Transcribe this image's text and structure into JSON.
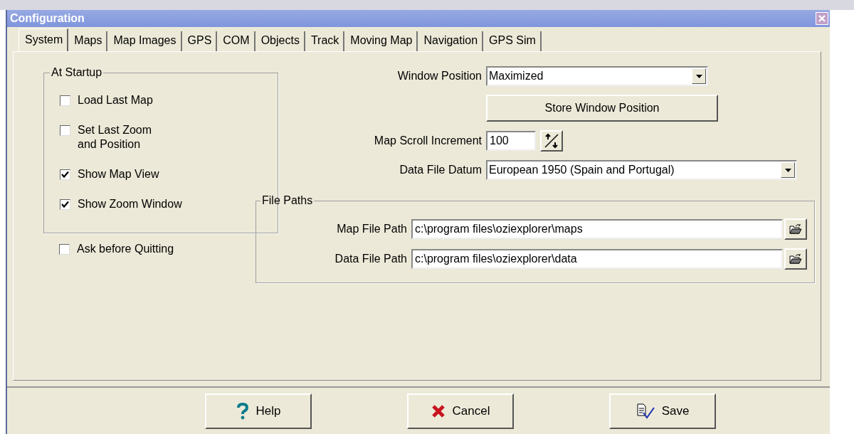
{
  "window": {
    "title": "Configuration"
  },
  "tabs": [
    {
      "label": "System",
      "selected": true
    },
    {
      "label": "Maps",
      "selected": false
    },
    {
      "label": "Map Images",
      "selected": false
    },
    {
      "label": "GPS",
      "selected": false
    },
    {
      "label": "COM",
      "selected": false
    },
    {
      "label": "Objects",
      "selected": false
    },
    {
      "label": "Track",
      "selected": false
    },
    {
      "label": "Moving Map",
      "selected": false
    },
    {
      "label": "Navigation",
      "selected": false
    },
    {
      "label": "GPS Sim",
      "selected": false
    }
  ],
  "at_startup": {
    "title": "At Startup",
    "options": [
      {
        "label": "Load Last Map",
        "checked": false
      },
      {
        "label": "Set Last Zoom\nand Position",
        "checked": false
      },
      {
        "label": "Show Map View",
        "checked": true
      },
      {
        "label": "Show Zoom Window",
        "checked": true
      }
    ]
  },
  "ask_before_quitting": {
    "label": "Ask before Quitting",
    "checked": false
  },
  "window_position": {
    "label": "Window Position",
    "value": "Maximized"
  },
  "store_button": "Store Window Position",
  "scroll_increment": {
    "label": "Map Scroll Increment",
    "value": "100"
  },
  "datum": {
    "label": "Data File Datum",
    "value": "European 1950 (Spain and Portugal)"
  },
  "file_paths": {
    "title": "File Paths",
    "paths": [
      {
        "label": "Map File Path",
        "value": "c:\\program files\\oziexplorer\\maps"
      },
      {
        "label": "Data File Path",
        "value": "c:\\program files\\oziexplorer\\data"
      }
    ]
  },
  "buttons": [
    {
      "kind": "help",
      "label": "Help"
    },
    {
      "kind": "cancel",
      "label": "Cancel"
    },
    {
      "kind": "save",
      "label": "Save"
    }
  ]
}
